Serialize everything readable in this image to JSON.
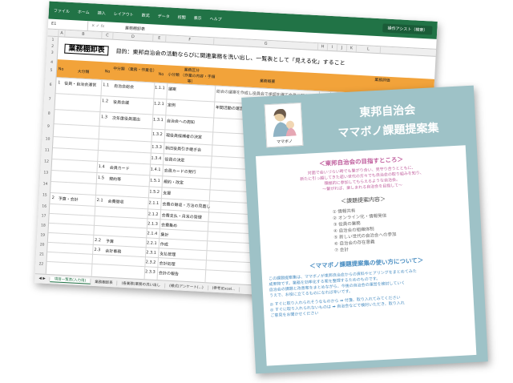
{
  "excel": {
    "ribbon": [
      "ファイル",
      "ホーム",
      "挿入",
      "レイアウト",
      "数式",
      "データ",
      "校閲",
      "表示",
      "ヘルプ"
    ],
    "search": "操作アシスト（検索）",
    "cell_ref": "E1",
    "formula_value": "業務棚卸表",
    "columns": [
      "A",
      "B",
      "C",
      "D",
      "E",
      "F",
      "G",
      "H",
      "I",
      "J",
      "K",
      "L"
    ],
    "rows": [
      "1",
      "2",
      "3",
      "4",
      "5",
      "6",
      "7",
      "8",
      "9",
      "10",
      "11",
      "12",
      "13",
      "14",
      "15",
      "16",
      "17",
      "18",
      "19",
      "20",
      "21",
      "22",
      "23",
      "24",
      "25",
      "26",
      "27",
      "28",
      "29",
      "30",
      "31",
      "32"
    ],
    "title": "業務棚卸表",
    "purpose": "目的：東邦自治会の活動ならびに関連業務を洗い出し、一覧表として「見える化」すること",
    "headers": {
      "no1": "No",
      "major": "大分類",
      "no2": "No",
      "middle": "中分類\n（業務・作業名）",
      "no3": "No",
      "group": "業務区分",
      "minor": "小分類\n（作業の内容・手順等）",
      "detail": "業務概要",
      "eval": "業務評価"
    },
    "cells": [
      {
        "key": "1",
        "text": "1"
      },
      {
        "key": "c1",
        "text": "役員・自治会運営"
      },
      {
        "key": "c2",
        "text": "1.1"
      },
      {
        "key": "c3",
        "text": "自治会総会"
      },
      {
        "key": "c4",
        "text": "1.1.1"
      },
      {
        "key": "c5",
        "text": "議案"
      },
      {
        "key": "c6",
        "text": "総会の議案を作成し役員会で承認を得て会員に配布する"
      },
      {
        "key": "c7",
        "text": "1.2"
      },
      {
        "key": "c8",
        "text": "役員会議"
      },
      {
        "key": "c9",
        "text": "1.2.1"
      },
      {
        "key": "c10",
        "text": "定例"
      },
      {
        "key": "c11",
        "text": "年間活動の運営"
      },
      {
        "key": "c12",
        "text": "1.3"
      },
      {
        "key": "c13",
        "text": "次年度役員選出"
      },
      {
        "key": "c14",
        "text": "1.3.1"
      },
      {
        "key": "c15",
        "text": "自治会への周知"
      },
      {
        "key": "c16",
        "text": "1.3.2"
      },
      {
        "key": "c17",
        "text": "現役員候補者の決定"
      },
      {
        "key": "c18",
        "text": "1.3.3"
      },
      {
        "key": "c19",
        "text": "新旧役員引き継ぎ会"
      },
      {
        "key": "c20",
        "text": "1.3.4"
      },
      {
        "key": "c21",
        "text": "役員の決定"
      },
      {
        "key": "c22",
        "text": "1.4"
      },
      {
        "key": "c23",
        "text": "会員カード"
      },
      {
        "key": "c24",
        "text": "1.4.1"
      },
      {
        "key": "c25",
        "text": "会員カードの発行"
      },
      {
        "key": "c26",
        "text": "1.5"
      },
      {
        "key": "c27",
        "text": "規約等"
      },
      {
        "key": "c28",
        "text": "1.5.1"
      },
      {
        "key": "c29",
        "text": "規約・改定"
      },
      {
        "key": "c30",
        "text": "1.5.2"
      },
      {
        "key": "c31",
        "text": "支援"
      },
      {
        "key": "c32",
        "text": "2"
      },
      {
        "key": "c33",
        "text": "予算・会計"
      },
      {
        "key": "c34",
        "text": "2.1"
      },
      {
        "key": "c35",
        "text": "会費徴収"
      },
      {
        "key": "c36",
        "text": "2.1.1"
      },
      {
        "key": "c37",
        "text": "会費の徴収・方法の見直し"
      },
      {
        "key": "c38",
        "text": "2.1.2"
      },
      {
        "key": "c39",
        "text": "会費支払・月末の管理"
      },
      {
        "key": "c40",
        "text": "2.1.3"
      },
      {
        "key": "c41",
        "text": "会費集め"
      },
      {
        "key": "c42",
        "text": "2.1.4"
      },
      {
        "key": "c43",
        "text": "集計"
      },
      {
        "key": "c44",
        "text": "2.2"
      },
      {
        "key": "c45",
        "text": "予算"
      },
      {
        "key": "c46",
        "text": "2.2.1"
      },
      {
        "key": "c47",
        "text": "作成"
      },
      {
        "key": "c48",
        "text": "2.3"
      },
      {
        "key": "c49",
        "text": "会計事務"
      },
      {
        "key": "c50",
        "text": "2.3.1"
      },
      {
        "key": "c51",
        "text": "支払管理"
      },
      {
        "key": "c52",
        "text": "2.3.2"
      },
      {
        "key": "c53",
        "text": "会計処理"
      },
      {
        "key": "c54",
        "text": "2.3.3"
      },
      {
        "key": "c55",
        "text": "会計の報告"
      }
    ],
    "sheet_tabs": [
      "項目一覧表(入力用)",
      "業務棚卸表",
      "(各業務)業務の洗い出し",
      "(様式)アンケート(...)",
      "(参考)Excel..."
    ]
  },
  "card": {
    "logo_caption": "ママボノ",
    "title_line1": "東邦自治会",
    "title_line2": "ママボノ課題提案集",
    "goal_heading": "＜東邦自治会の目指すところ＞",
    "goal_text": [
      "対面で会いづらい時でも繋がり合い、見守り合うとともに、",
      "新たに引っ越してきた若い世代の方々でも自治会の取り組みを知り、",
      "積極的に参加してもらえるような自治会。",
      "～繋がれば、楽しまれる自治会を目指して～"
    ],
    "content_heading": "＜課題提案内容＞",
    "items": [
      "① 情報共有",
      "② オンライン化・情報発信",
      "③ 役員の業務",
      "④ 自治会の組織体制",
      "⑤ 新しい世代の自治会への参加",
      "⑥ 自治会の存在意義",
      "⑦ 会計"
    ],
    "usage_heading": "＜ママボノ課題提案集の使い方について＞",
    "usage_text": [
      "この課題提案集は、ママボノが東邦自治会からの資料やヒアリングをまとめてみた",
      "成果物です。業務を効率化する案を整理するためのものです。",
      "自治会の課題と改善案をまとめながら、今後の自治会の運営を検討していく",
      "うえで、お役に立てるものになれば幸いです。"
    ],
    "tips": [
      "◎ すぐに取り入れられそうなものから ➡ 付箋、取り入れてみてください",
      "◎ すぐに取り入れられないものは ➡ 自治会などで検討いただき、取り入れ",
      "   ご意見をお聞かせください"
    ]
  }
}
